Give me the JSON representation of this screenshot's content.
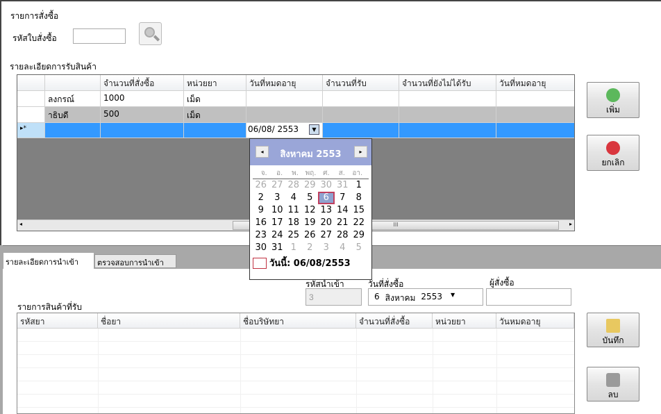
{
  "order": {
    "section_title": "รายการสั่งซื้อ",
    "order_id_label": "รหัสใบสั่งซื้อ",
    "order_id_value": "",
    "search_icon": "magnifier-icon"
  },
  "receive": {
    "section_title": "รายละเอียดการรับสินค้า",
    "columns": [
      "",
      "จำนวนที่สั่งซื้อ",
      "หน่วยยา",
      "วันที่หมดอายุ",
      "จำนวนที่รับ",
      "จำนวนที่ยังไม่ได้รับ",
      "วันที่หมดอายุ"
    ],
    "rows": [
      [
        "ลงกรณ์",
        "1000",
        "เม็ด",
        "",
        "",
        "",
        ""
      ],
      [
        "าธิบดี",
        "500",
        "เม็ด",
        "",
        "",
        "",
        ""
      ]
    ],
    "new_row_marker": "▸*",
    "editing_date": "06/08/  2553",
    "scroll_grip": "III"
  },
  "buttons": {
    "add": "เพิ่ม",
    "cancel": "ยกเลิก",
    "save": "บันทึก",
    "delete": "ลบ"
  },
  "calendar": {
    "title": "สิงหาคม 2553",
    "day_names": [
      "จ.",
      "อ.",
      "พ.",
      "พฤ.",
      "ศ.",
      "ส.",
      "อา."
    ],
    "weeks": [
      [
        "26",
        "27",
        "28",
        "29",
        "30",
        "31",
        "1"
      ],
      [
        "2",
        "3",
        "4",
        "5",
        "6",
        "7",
        "8"
      ],
      [
        "9",
        "10",
        "11",
        "12",
        "13",
        "14",
        "15"
      ],
      [
        "16",
        "17",
        "18",
        "19",
        "20",
        "21",
        "22"
      ],
      [
        "23",
        "24",
        "25",
        "26",
        "27",
        "28",
        "29"
      ],
      [
        "30",
        "31",
        "1",
        "2",
        "3",
        "4",
        "5"
      ]
    ],
    "selected": "6",
    "today_label": "วันนี้: 06/08/2553"
  },
  "tabs": [
    "รายละเอียดการนำเข้า",
    "ตรวจสอบการนำเข้า"
  ],
  "import": {
    "import_id_label": "รหัสนำเข้า",
    "import_id_value": "3",
    "order_date_label": "วันที่สั่งซื้อ",
    "order_date_day": "6",
    "order_date_month": "สิงหาคม",
    "order_date_year": "2553",
    "orderer_label": "ผู้สั่งซื้อ",
    "orderer_value": "",
    "items_title": "รายการสินค้าที่รับ",
    "columns": [
      "รหัสยา",
      "ชื่อยา",
      "ชื่อบริษัทยา",
      "จำนวนที่สั่งซื้อ",
      "หน่วยยา",
      "วันหมดอายุ"
    ]
  }
}
